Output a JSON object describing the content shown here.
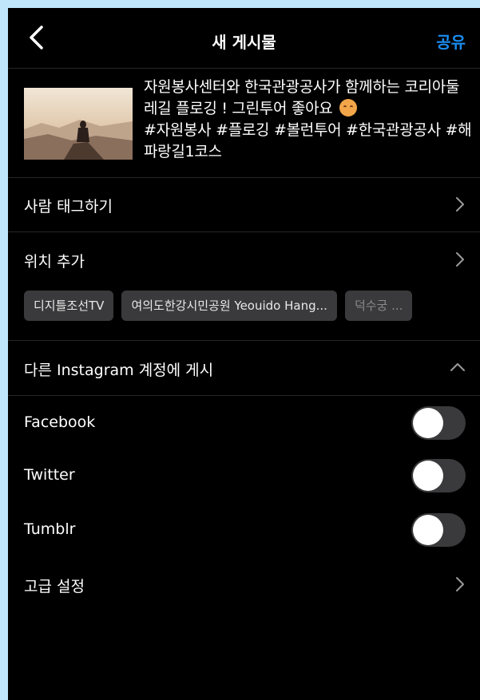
{
  "header": {
    "title": "새 게시물",
    "share_label": "공유",
    "accent_color": "#1a8cf0"
  },
  "caption": {
    "text": "자원봉사센터와 한국관광공사가 함께하는 코리아둘레길 플로깅 ! 그린투어 좋아요",
    "hashtags": "#자원봉사 #플로깅 #볼런투어 #한국관광공사 #해파랑길1코스"
  },
  "rows": {
    "tag_people": "사람 태그하기",
    "add_location": "위치 추가",
    "other_accounts": "다른 Instagram 계정에 게시",
    "advanced": "고급 설정"
  },
  "location_chips": [
    "디지틀조선TV",
    "여의도한강시민공원 Yeouido Hang...",
    "덕수궁 ..."
  ],
  "share_targets": [
    {
      "label": "Facebook",
      "enabled": false
    },
    {
      "label": "Twitter",
      "enabled": false
    },
    {
      "label": "Tumblr",
      "enabled": false
    }
  ],
  "icons": {
    "back": "chevron-left-icon",
    "row_chevron": "chevron-right-icon",
    "collapse": "chevron-up-icon"
  }
}
